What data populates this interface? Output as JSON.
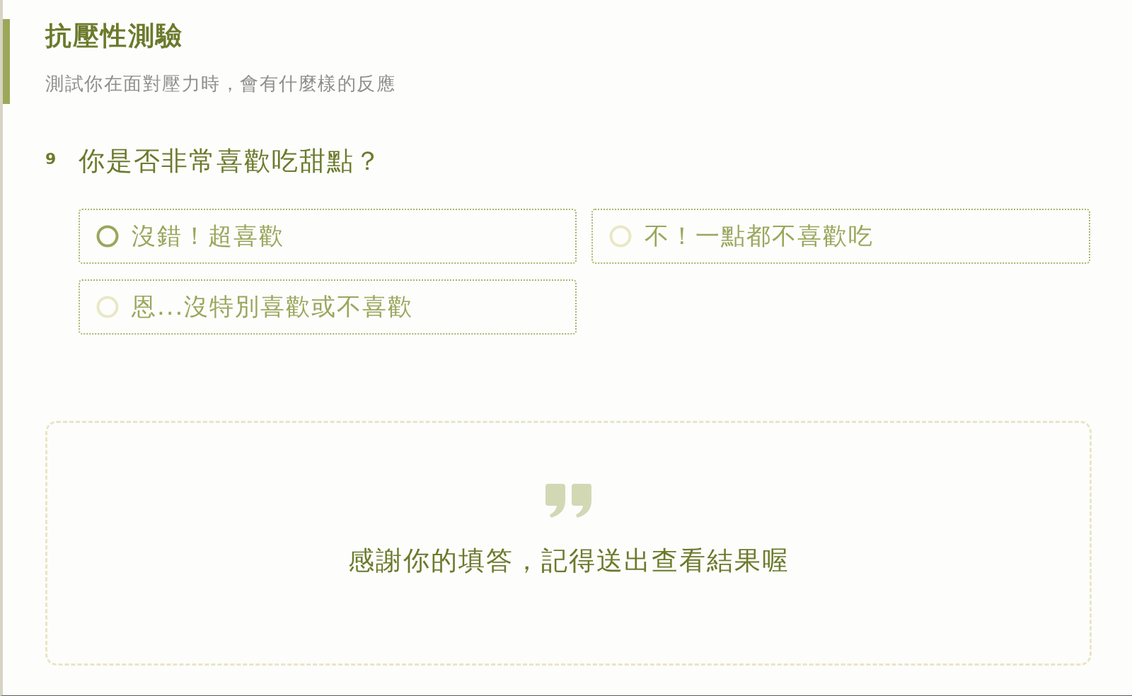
{
  "header": {
    "title": "抗壓性測驗",
    "subtitle": "測試你在面對壓力時，會有什麼樣的反應"
  },
  "question": {
    "number": "9",
    "text": "你是否非常喜歡吃甜點？",
    "options": [
      {
        "label": "沒錯！超喜歡",
        "selected": false,
        "hovered": true
      },
      {
        "label": "不！一點都不喜歡吃",
        "selected": false,
        "hovered": false
      },
      {
        "label": "恩...沒特別喜歡或不喜歡",
        "selected": false,
        "hovered": false
      }
    ]
  },
  "completion_card": {
    "message": "感謝你的填答，記得送出查看結果喔"
  }
}
